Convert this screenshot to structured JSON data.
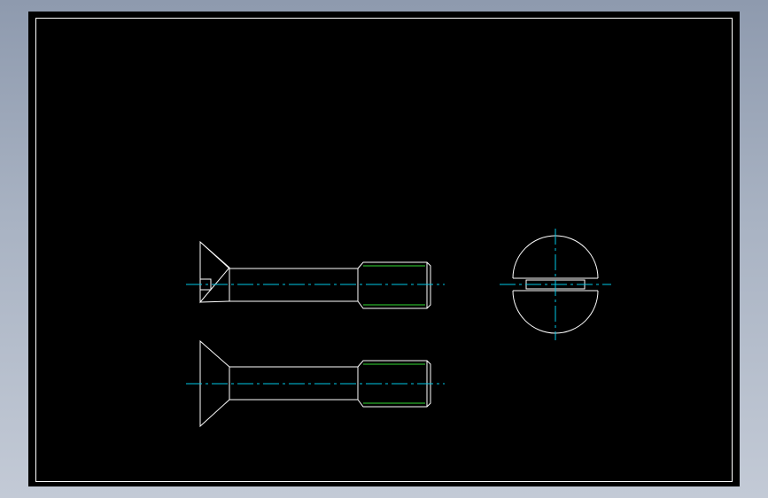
{
  "viewport": {
    "background": "#000000",
    "frame_gradient_top": "#8e9aae",
    "frame_gradient_bottom": "#c3cad6"
  },
  "colors": {
    "outline": "#ffffff",
    "centerline": "#00c8e6",
    "thread": "#33dd33"
  },
  "views": [
    {
      "name": "front-view-sectioned"
    },
    {
      "name": "front-view"
    },
    {
      "name": "head-end-view"
    }
  ]
}
